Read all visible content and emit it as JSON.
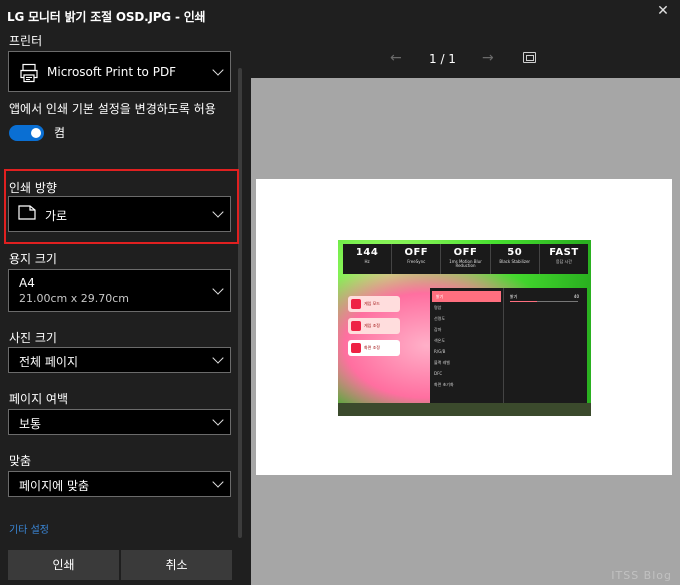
{
  "window": {
    "title": "LG 모니터 밝기 조절 OSD.JPG - 인쇄",
    "close_glyph": "✕"
  },
  "settings": {
    "printer": {
      "label": "프린터",
      "value": "Microsoft Print to PDF",
      "icon": "printer-icon"
    },
    "app_setting": {
      "label": "앱에서 인쇄 기본 설정을 변경하도록 허용",
      "state": "켬",
      "on": true
    },
    "orientation": {
      "label": "인쇄 방향",
      "value": "가로",
      "icon": "page-icon"
    },
    "paper_size": {
      "label": "용지 크기",
      "value": "A4",
      "detail": "21.00cm x 29.70cm"
    },
    "photo_size": {
      "label": "사진 크기",
      "value": "전체 페이지"
    },
    "margins": {
      "label": "페이지 여백",
      "value": "보통"
    },
    "fit": {
      "label": "맞춤",
      "value": "페이지에 맞춤"
    },
    "more_settings": "기타 설정",
    "print_button": "인쇄",
    "cancel_button": "취소"
  },
  "preview": {
    "page_indicator": "1 / 1",
    "prev_glyph": "←",
    "next_glyph": "→",
    "osd": {
      "stats": [
        {
          "value": "144",
          "label": "Hz"
        },
        {
          "value": "OFF",
          "label": "FreeSync"
        },
        {
          "value": "OFF",
          "label": "1ms Motion Blur Reduction"
        },
        {
          "value": "50",
          "label": "Black Stabilizer"
        },
        {
          "value": "FAST",
          "label": "응답 시간"
        }
      ],
      "side_items": [
        "게임 모드",
        "게임 조정",
        "화면 조정"
      ],
      "menu_items": [
        "밝기",
        "명암",
        "선명도",
        "감마",
        "색온도",
        "R/G/B",
        "블랙 레벨",
        "DFC",
        "화면 초기화"
      ],
      "slider_label": "밝기",
      "slider_value": "40",
      "slider_level": 0.4
    }
  },
  "watermark": "ITSS Blog",
  "colors": {
    "background": "#1f1f1f",
    "accent": "#0a6fd3",
    "highlight": "#e02020",
    "link": "#3a86d6",
    "preview_bg": "#a6a6a6"
  }
}
